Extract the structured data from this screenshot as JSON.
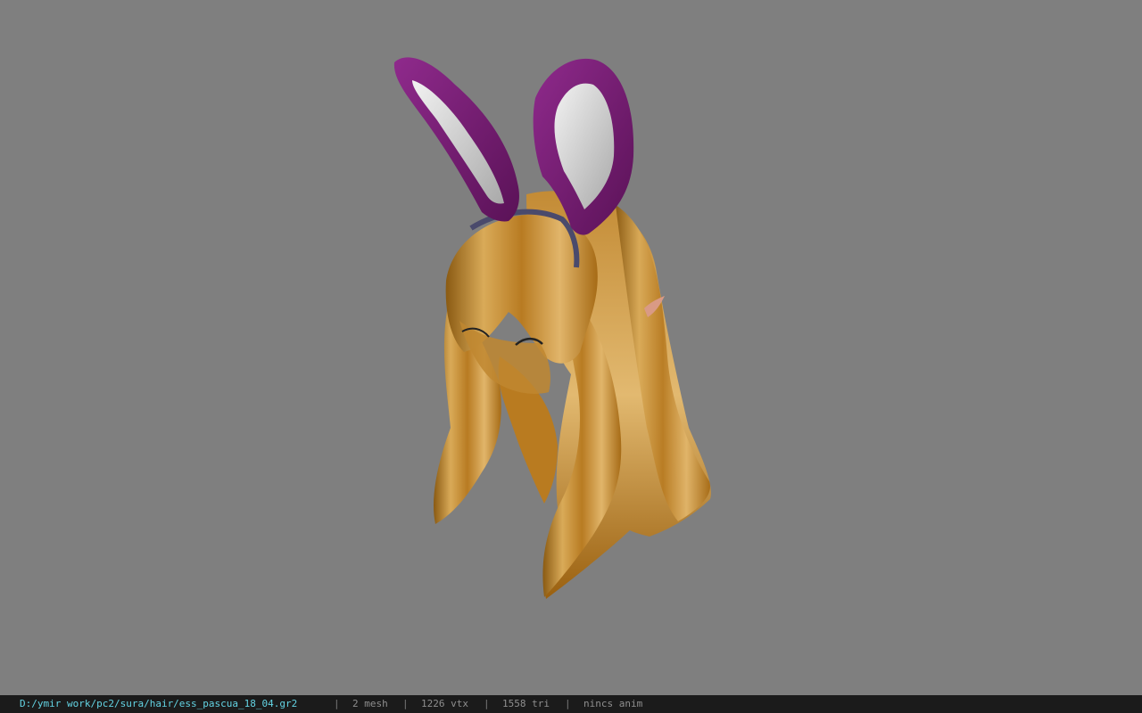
{
  "viewer": {
    "background_color": "#7f7f7f",
    "model_colors": {
      "hair_light": "#d8a754",
      "hair_mid": "#b87c23",
      "hair_dark": "#6e4309",
      "ear_purple": "#7b1d78",
      "ear_inner": "#d9d9d9",
      "band": "#4a4a6c",
      "elf_ear": "#d99a85"
    }
  },
  "statusbar": {
    "file_path": "D:/ymir work/pc2/sura/hair/ess_pascua_18_04.gr2",
    "separator": "|",
    "mesh_count": "2 mesh",
    "vertex_count": "1226 vtx",
    "triangle_count": "1558 tri",
    "anim_status": "nincs anim",
    "path_color": "#63d3e3",
    "text_color": "#8f8f8f",
    "bg_color": "#1b1b1b"
  }
}
